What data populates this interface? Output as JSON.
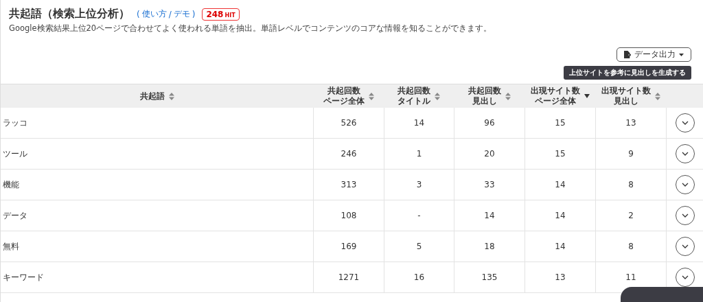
{
  "header": {
    "title": "共起語（検索上位分析）",
    "help_open": "(",
    "help_links": [
      {
        "label": "使い方"
      },
      {
        "label": "デモ"
      }
    ],
    "help_separator": "/",
    "help_close": ")",
    "hit_count": "248",
    "hit_unit": "HIT",
    "description": "Google検索結果上位20ページで合わせてよく使われる単語を抽出。単語レベルでコンテンツのコアな情報を知ることができます。"
  },
  "actions": {
    "export_button": "データ出力",
    "generate_button": "上位サイトを参考に見出しを生成する"
  },
  "table": {
    "columns": [
      {
        "lines": [
          "共起語"
        ],
        "sorted_descending": false
      },
      {
        "lines": [
          "共起回数",
          "ページ全体"
        ],
        "sorted_descending": false
      },
      {
        "lines": [
          "共起回数",
          "タイトル"
        ],
        "sorted_descending": false
      },
      {
        "lines": [
          "共起回数",
          "見出し"
        ],
        "sorted_descending": false
      },
      {
        "lines": [
          "出現サイト数",
          "ページ全体"
        ],
        "sorted_descending": true
      },
      {
        "lines": [
          "出現サイト数",
          "見出し"
        ],
        "sorted_descending": false
      }
    ],
    "rows": [
      {
        "cells": [
          "ラッコ",
          "526",
          "14",
          "96",
          "15",
          "13"
        ]
      },
      {
        "cells": [
          "ツール",
          "246",
          "1",
          "20",
          "15",
          "9"
        ]
      },
      {
        "cells": [
          "機能",
          "313",
          "3",
          "33",
          "14",
          "8"
        ]
      },
      {
        "cells": [
          "データ",
          "108",
          "-",
          "14",
          "14",
          "2"
        ]
      },
      {
        "cells": [
          "無料",
          "169",
          "5",
          "18",
          "14",
          "8"
        ]
      },
      {
        "cells": [
          "キーワード",
          "1271",
          "16",
          "135",
          "13",
          "11"
        ]
      }
    ]
  }
}
